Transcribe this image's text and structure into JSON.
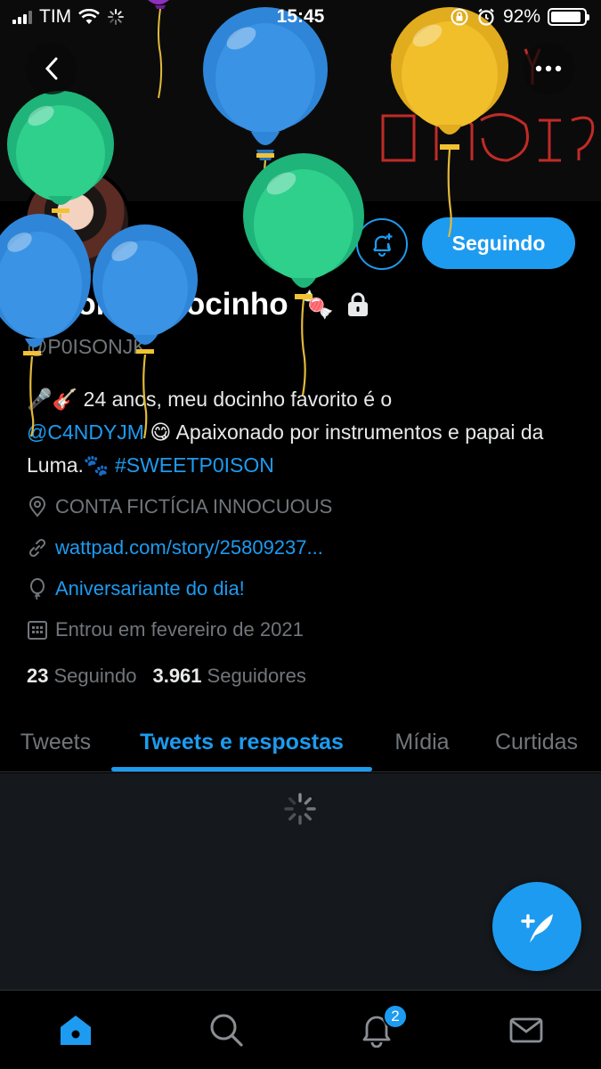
{
  "status_bar": {
    "carrier": "TIM",
    "time": "15:45",
    "battery": "92%",
    "battery_level": 0.92
  },
  "banner": {
    "neon_text_line1": "WHAT'S YOUR",
    "neon_text_line2": "P0ISON?"
  },
  "profile": {
    "display_name": "Amor do Docinho",
    "handle": "@P0ISONJK",
    "follow_label": "Seguindo",
    "bio_prefix": "🎤🎸 24 anos, meu docinho favorito é o",
    "bio_mention": "@C4NDYJM",
    "bio_middle": "😋 Apaixonado por instrumentos e papai da Luma.🐾",
    "bio_hashtag": "#SWEETP0ISON",
    "location": "CONTA FICTÍCIA INNOCUOUS",
    "website": "wattpad.com/story/25809237...",
    "birthday": "Aniversariante do dia!",
    "joined": "Entrou em fevereiro de 2021",
    "following_count": "23",
    "following_label": "Seguindo",
    "followers_count": "3.961",
    "followers_label": "Seguidores"
  },
  "tabs": [
    {
      "label": "Tweets"
    },
    {
      "label": "Tweets e respostas"
    },
    {
      "label": "Mídia"
    },
    {
      "label": "Curtidas"
    }
  ],
  "bottom_nav": {
    "notifications_badge": "2"
  },
  "colors": {
    "accent": "#1d9bf0",
    "background": "#000000",
    "muted": "#71767b"
  }
}
